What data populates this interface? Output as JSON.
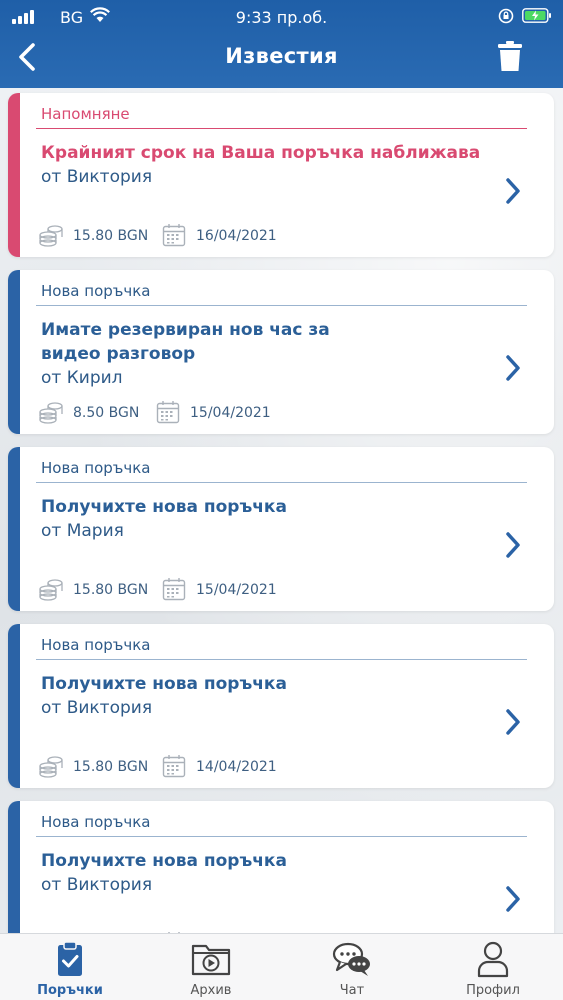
{
  "status_bar": {
    "carrier": "BG",
    "time": "9:33 пр.об."
  },
  "header": {
    "title": "Известия"
  },
  "notifications": [
    {
      "category": "Напомняне",
      "title": "Крайният срок на Ваша поръчка наближава",
      "from": "от Виктория",
      "amount": "15.80 BGN",
      "date": "16/04/2021",
      "accent": "#d94a71"
    },
    {
      "category": "Нова поръчка",
      "title": "Имате резервиран нов час за видео разговор",
      "from": "от Кирил",
      "amount": "8.50 BGN",
      "date": "15/04/2021",
      "accent": "#2b63a6"
    },
    {
      "category": "Нова поръчка",
      "title": "Получихте нова поръчка",
      "from": "от Мария",
      "amount": "15.80 BGN",
      "date": "15/04/2021",
      "accent": "#2b63a6"
    },
    {
      "category": "Нова поръчка",
      "title": "Получихте нова поръчка",
      "from": "от Виктория",
      "amount": "15.80 BGN",
      "date": "14/04/2021",
      "accent": "#2b63a6"
    },
    {
      "category": "Нова поръчка",
      "title": "Получихте нова поръчка",
      "from": "от Виктория",
      "accent": "#2b63a6"
    }
  ],
  "tabs": [
    {
      "label": "Поръчки",
      "icon": "clipboard-check-icon",
      "active": true
    },
    {
      "label": "Архив",
      "icon": "video-folder-icon",
      "active": false
    },
    {
      "label": "Чат",
      "icon": "chat-bubbles-icon",
      "active": false
    },
    {
      "label": "Профил",
      "icon": "person-icon",
      "active": false
    }
  ],
  "colors": {
    "brand_blue": "#2b63a6",
    "reminder_pink": "#d94a71"
  }
}
